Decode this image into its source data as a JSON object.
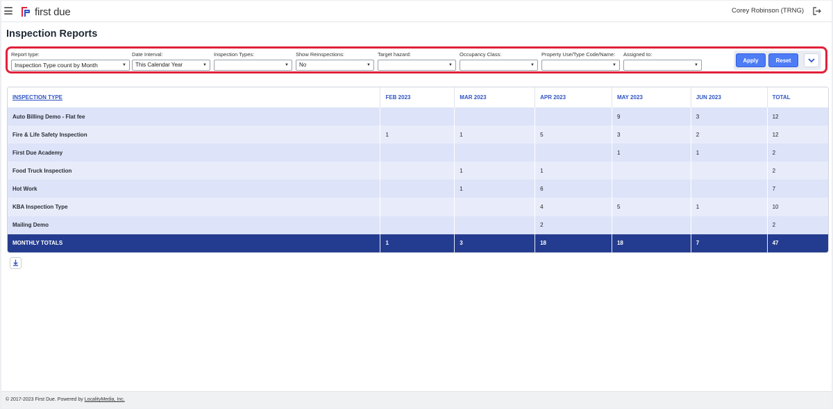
{
  "app": {
    "brand": "first due",
    "user": "Corey Robinson (TRNG)",
    "page_title": "Inspection Reports"
  },
  "filters": [
    {
      "label": "Report type:",
      "value": "Inspection Type count by Month"
    },
    {
      "label": "Date Interval:",
      "value": "This Calendar Year"
    },
    {
      "label": "Inspection Types:",
      "value": ""
    },
    {
      "label": "Show Reinspections:",
      "value": "No"
    },
    {
      "label": "Target hazard:",
      "value": ""
    },
    {
      "label": "Occupancy Class:",
      "value": ""
    },
    {
      "label": "Property Use/Type Code/Name:",
      "value": ""
    },
    {
      "label": "Assigned to:",
      "value": ""
    }
  ],
  "buttons": {
    "apply": "Apply",
    "reset": "Reset"
  },
  "table": {
    "columns": [
      "INSPECTION TYPE",
      "FEB 2023",
      "MAR 2023",
      "APR 2023",
      "MAY 2023",
      "JUN 2023",
      "TOTAL"
    ],
    "rows": [
      [
        "Auto Billing Demo - Flat fee",
        "",
        "",
        "",
        "9",
        "3",
        "12"
      ],
      [
        "Fire & Life Safety Inspection",
        "1",
        "1",
        "5",
        "3",
        "2",
        "12"
      ],
      [
        "First Due Academy",
        "",
        "",
        "",
        "1",
        "1",
        "2"
      ],
      [
        "Food Truck Inspection",
        "",
        "1",
        "1",
        "",
        "",
        "2"
      ],
      [
        "Hot Work",
        "",
        "1",
        "6",
        "",
        "",
        "7"
      ],
      [
        "KBA Inspection Type",
        "",
        "",
        "4",
        "5",
        "1",
        "10"
      ],
      [
        "Mailing Demo",
        "",
        "",
        "2",
        "",
        "",
        "2"
      ]
    ],
    "totals": [
      "MONTHLY TOTALS",
      "1",
      "3",
      "18",
      "18",
      "7",
      "47"
    ]
  },
  "footer": {
    "text": "© 2017-2023 First Due. Powered by ",
    "link": "LocalityMedia, Inc."
  },
  "colors": {
    "highlight_border": "#e0203a",
    "header_text": "#2e53c4",
    "totals_bg": "#243c8f",
    "button_bg": "#4e7cf5"
  },
  "icons": [
    "menu-icon",
    "first-due-logo-icon",
    "logout-icon",
    "caret-down-icon",
    "chevron-down-icon",
    "download-icon"
  ]
}
